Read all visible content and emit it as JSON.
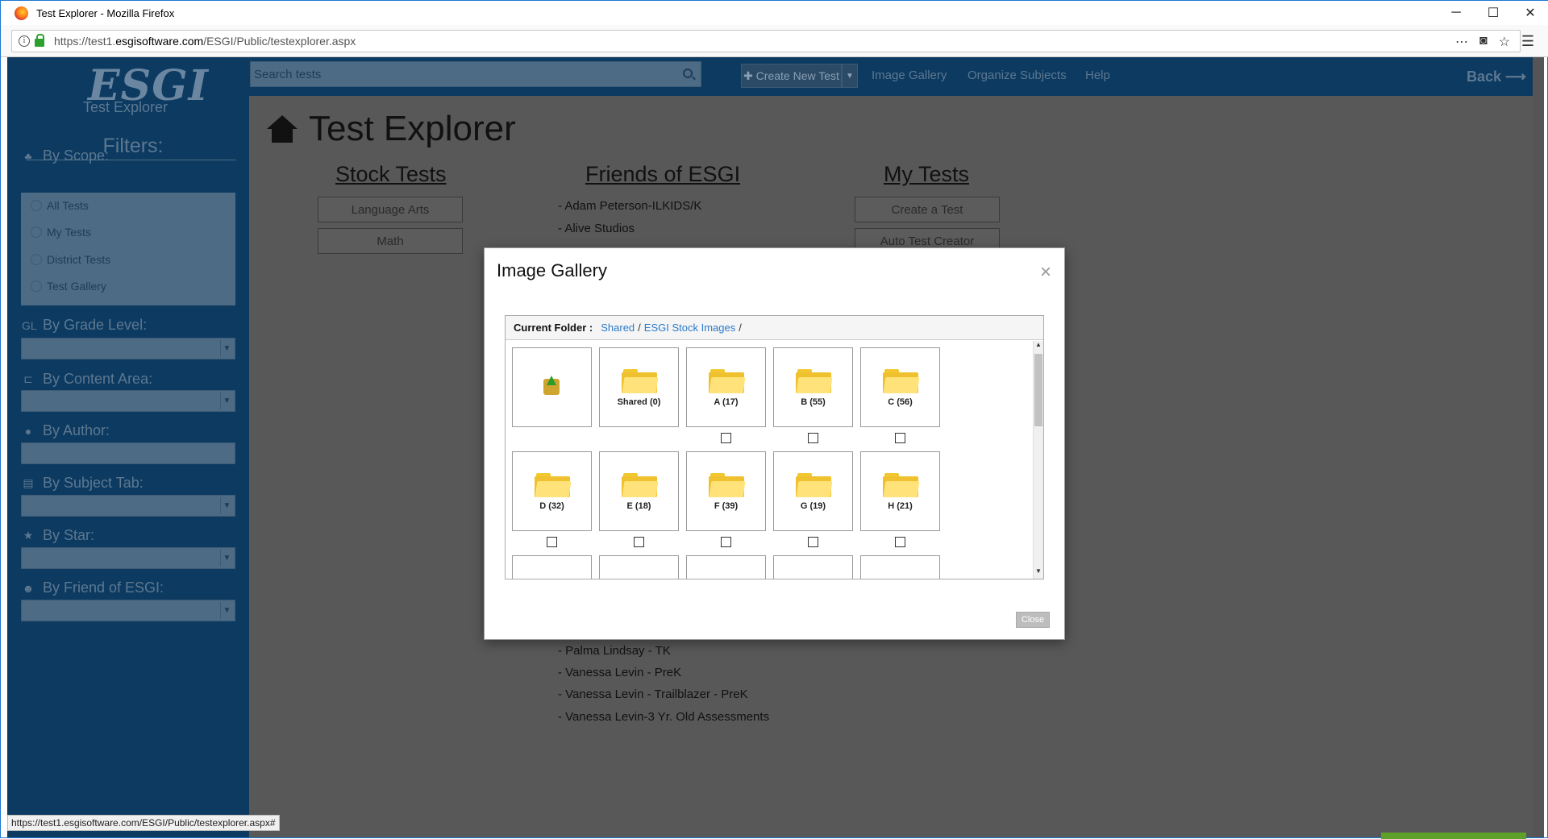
{
  "window": {
    "title": "Test Explorer - Mozilla Firefox",
    "minimize": "─",
    "maximize": "☐",
    "close": "✕"
  },
  "urlbar": {
    "url_prefix": "https://test1.",
    "url_domain": "esgisoftware.com",
    "url_path": "/ESGI/Public/testexplorer.aspx"
  },
  "sidebar": {
    "logo": "ESGI",
    "logo_sub": "Test Explorer",
    "filters_title": "Filters:",
    "scope_label": "By Scope:",
    "scope_items": [
      "All Tests",
      "My Tests",
      "District Tests",
      "Test Gallery"
    ],
    "grade_icon_text": "GL",
    "grade_label": "By Grade Level:",
    "content_label": "By Content Area:",
    "author_label": "By Author:",
    "subject_label": "By Subject Tab:",
    "star_label": "By Star:",
    "friend_label": "By Friend of ESGI:"
  },
  "topnav": {
    "search_placeholder": "Search tests",
    "create_label": "✚ Create New Test",
    "links": [
      "Image Gallery",
      "Organize Subjects",
      "Help"
    ],
    "back": "Back ⟶"
  },
  "main": {
    "title": "Test Explorer",
    "stock_heading": "Stock Tests",
    "stock_buttons": [
      "Language Arts",
      "Math"
    ],
    "friends_heading": "Friends of ESGI",
    "friends_top": [
      "- Adam Peterson-ILKIDS/K",
      "- Alive Studios"
    ],
    "friends_bottom": [
      "- Palma Lindsay - TK",
      "- Vanessa Levin - PreK",
      "- Vanessa Levin - Trailblazer - PreK",
      "- Vanessa Levin-3 Yr. Old Assessments"
    ],
    "mytests_heading": "My Tests",
    "mytests_buttons": [
      "Create a Test",
      "Auto Test Creator"
    ]
  },
  "modal": {
    "title": "Image Gallery",
    "close_x": "×",
    "current_folder_label": "Current Folder :",
    "crumb_1": "Shared",
    "crumb_sep": "/",
    "crumb_2": "ESGI Stock Images",
    "folders_row1": [
      "Shared (0)",
      "A (17)",
      "B (55)",
      "C (56)"
    ],
    "folders_row2": [
      "D (32)",
      "E (18)",
      "F (39)",
      "G (19)",
      "H (21)"
    ],
    "close_button": "Close"
  },
  "statusbar": {
    "text": "https://test1.esgisoftware.com/ESGI/Public/testexplorer.aspx#"
  },
  "colors": {
    "sidebar": "#0c3a61",
    "overlay": "#585858",
    "link": "#2c7ac9",
    "folder": "#f0c12e"
  }
}
